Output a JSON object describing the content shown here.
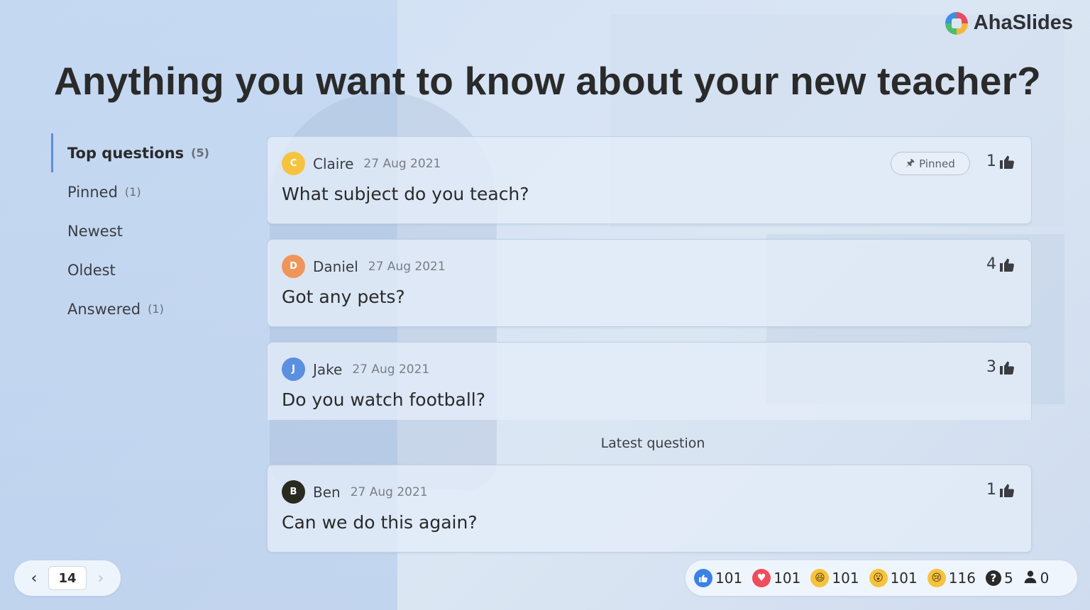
{
  "brand": {
    "name": "AhaSlides"
  },
  "slide": {
    "title": "Anything you want to know about your new teacher?"
  },
  "sidebar": {
    "items": [
      {
        "label": "Top questions",
        "count": "(5)",
        "active": true
      },
      {
        "label": "Pinned",
        "count": "(1)"
      },
      {
        "label": "Newest",
        "count": ""
      },
      {
        "label": "Oldest",
        "count": ""
      },
      {
        "label": "Answered",
        "count": "(1)"
      }
    ]
  },
  "questions": [
    {
      "initial": "C",
      "author": "Claire",
      "date": "27 Aug 2021",
      "text": "What subject do you teach?",
      "votes": "1",
      "pinned_label": "Pinned",
      "avatar_color": "#f6c33e"
    },
    {
      "initial": "D",
      "author": "Daniel",
      "date": "27 Aug 2021",
      "text": "Got any pets?",
      "votes": "4",
      "avatar_color": "#f0955a"
    },
    {
      "initial": "J",
      "author": "Jake",
      "date": "27 Aug 2021",
      "text": "Do you watch football?",
      "votes": "3",
      "avatar_color": "#5b8fe0"
    }
  ],
  "latest": {
    "label": "Latest question",
    "question": {
      "initial": "B",
      "author": "Ben",
      "date": "27 Aug 2021",
      "text": "Can we do this again?",
      "votes": "1",
      "avatar_color": "#2b2a20"
    }
  },
  "pager": {
    "current": "14"
  },
  "reactions": {
    "like": "101",
    "heart": "101",
    "laugh": "101",
    "wow": "101",
    "sad": "116",
    "questions": "5",
    "audience": "0"
  },
  "colors": {
    "accent": "#5b8fe0",
    "like": "#3b82e6",
    "heart": "#ef4d5a",
    "emoji": "#f6c33e"
  },
  "icons": {
    "logo": "ahaslides-logo-icon",
    "thumb": "thumbs-up-icon",
    "pin": "pin-icon",
    "prev": "chevron-left-icon",
    "next": "chevron-right-icon",
    "question": "question-mark-icon",
    "audience": "user-icon"
  }
}
